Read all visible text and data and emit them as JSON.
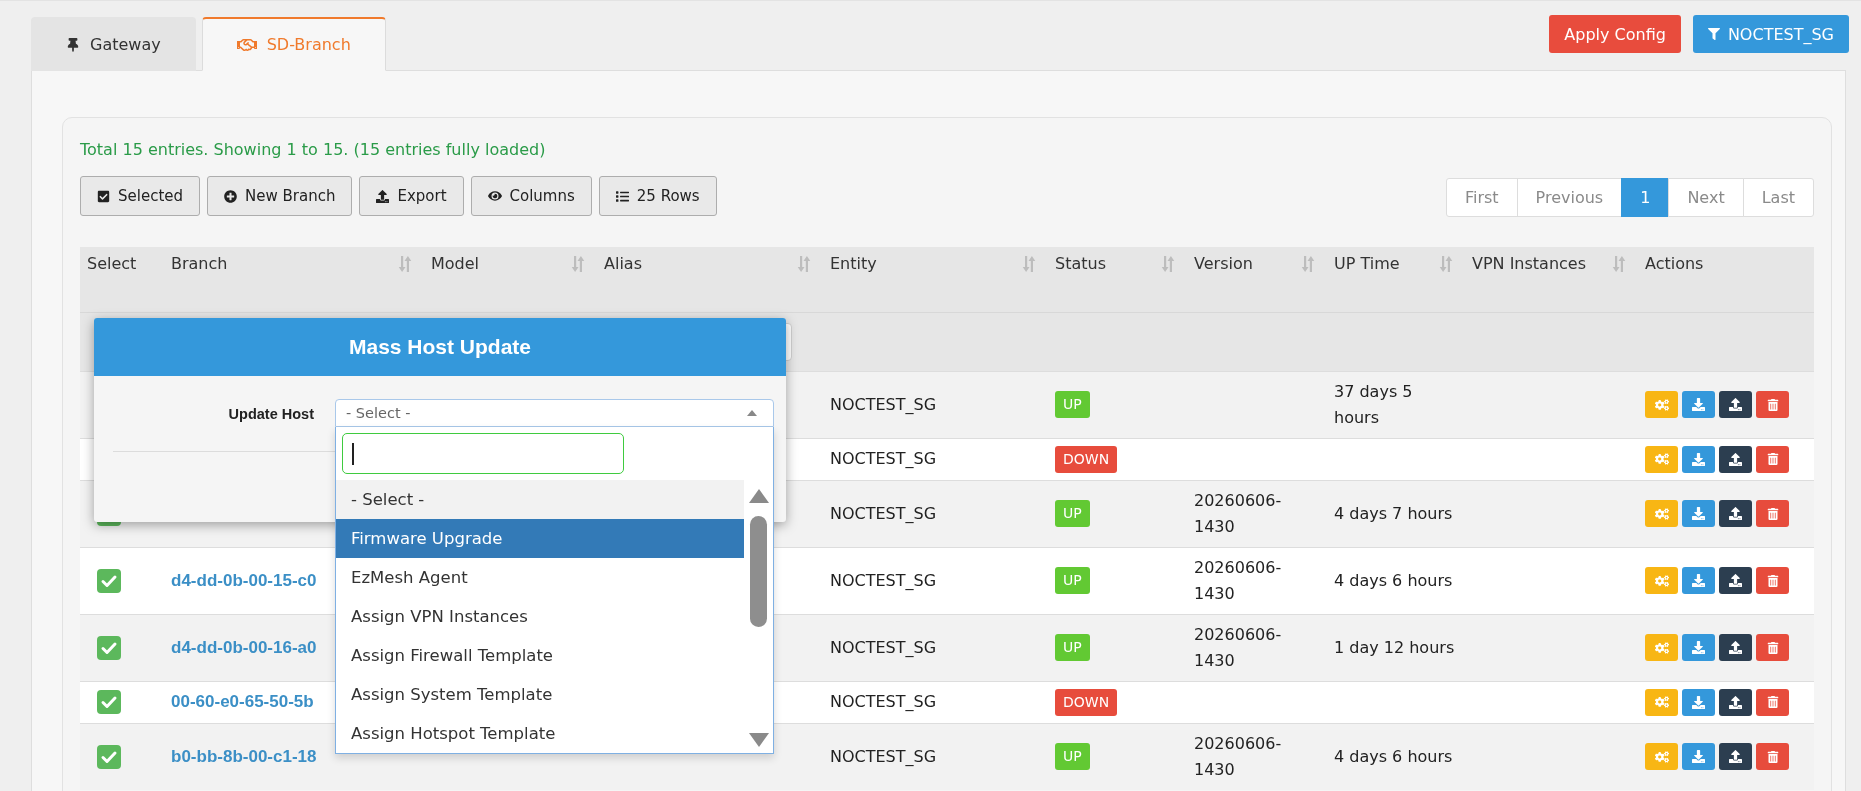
{
  "tabs": [
    {
      "label": "Gateway",
      "selected": false
    },
    {
      "label": "SD-Branch",
      "selected": true
    }
  ],
  "header_buttons": [
    {
      "label": "Apply Config",
      "kind": "danger"
    },
    {
      "label": "NOCTEST_SG",
      "kind": "filter"
    }
  ],
  "summary": "Total 15 entries. Showing 1 to 15. (15 entries fully loaded)",
  "toolbar": [
    "Selected",
    "New Branch",
    "Export",
    "Columns",
    "25 Rows"
  ],
  "pagination": [
    {
      "label": "First",
      "selected": false
    },
    {
      "label": "Previous",
      "selected": false
    },
    {
      "label": "1",
      "selected": true
    },
    {
      "label": "Next",
      "selected": false
    },
    {
      "label": "Last",
      "selected": false
    }
  ],
  "table": {
    "columns": [
      {
        "label": "Select",
        "kind": "select",
        "sortable": false,
        "filter": false
      },
      {
        "label": "Branch",
        "kind": "branch",
        "sortable": true,
        "filter": false
      },
      {
        "label": "Model",
        "kind": "model",
        "sortable": true,
        "filter": false
      },
      {
        "label": "Alias",
        "kind": "alias",
        "sortable": true,
        "filter": true
      },
      {
        "label": "Entity",
        "kind": "entity",
        "sortable": true,
        "filter": false
      },
      {
        "label": "Status",
        "kind": "status",
        "sortable": true,
        "filter": false
      },
      {
        "label": "Version",
        "kind": "version",
        "sortable": true,
        "filter": false
      },
      {
        "label": "UP Time",
        "kind": "up_time",
        "sortable": true,
        "filter": false
      },
      {
        "label": "VPN Instances",
        "kind": "vpn_instances",
        "sortable": true,
        "filter": false
      },
      {
        "label": "Actions",
        "kind": "actions",
        "sortable": false,
        "filter": false
      }
    ],
    "rows": [
      {
        "entity": "NOCTEST_SG",
        "status": {
          "label": "UP",
          "color": "#62c933"
        },
        "up_time": "37 days 5 hours"
      },
      {
        "entity": "NOCTEST_SG",
        "status": {
          "label": "DOWN",
          "color": "#e74c3c"
        }
      },
      {
        "checked": true,
        "entity": "NOCTEST_SG",
        "status": {
          "label": "UP",
          "color": "#62c933"
        },
        "version": "20260606-1430",
        "up_time": "4 days 7 hours"
      },
      {
        "checked": true,
        "branch": "d4-dd-0b-00-15-c0",
        "entity": "NOCTEST_SG",
        "status": {
          "label": "UP",
          "color": "#62c933"
        },
        "version": "20260606-1430",
        "up_time": "4 days 6 hours"
      },
      {
        "checked": true,
        "branch": "d4-dd-0b-00-16-a0",
        "entity": "NOCTEST_SG",
        "status": {
          "label": "UP",
          "color": "#62c933"
        },
        "version": "20260606-1430",
        "up_time": "1 day 12 hours"
      },
      {
        "checked": true,
        "branch": "00-60-e0-65-50-5b",
        "entity": "NOCTEST_SG",
        "status": {
          "label": "DOWN",
          "color": "#e74c3c"
        }
      },
      {
        "checked": true,
        "branch": "b0-bb-8b-00-c1-18",
        "entity": "NOCTEST_SG",
        "status": {
          "label": "UP",
          "color": "#62c933"
        },
        "version": "20260606-1430",
        "up_time": "4 days 6 hours"
      }
    ]
  },
  "dialog": {
    "title": "Mass Host Update",
    "field_label": "Update Host",
    "select": {
      "value": "- Select -",
      "expanded": true,
      "search_focused": true,
      "options": [
        {
          "label": "- Select -",
          "selected": true,
          "highlighted": false
        },
        {
          "label": "Firmware Upgrade",
          "selected": false,
          "highlighted": true
        },
        {
          "label": "EzMesh Agent",
          "selected": false,
          "highlighted": false
        },
        {
          "label": "Assign VPN Instances",
          "selected": false,
          "highlighted": false
        },
        {
          "label": "Assign Firewall Template",
          "selected": false,
          "highlighted": false
        },
        {
          "label": "Assign System Template",
          "selected": false,
          "highlighted": false
        },
        {
          "label": "Assign Hotspot Template",
          "selected": false,
          "highlighted": false
        }
      ]
    }
  }
}
